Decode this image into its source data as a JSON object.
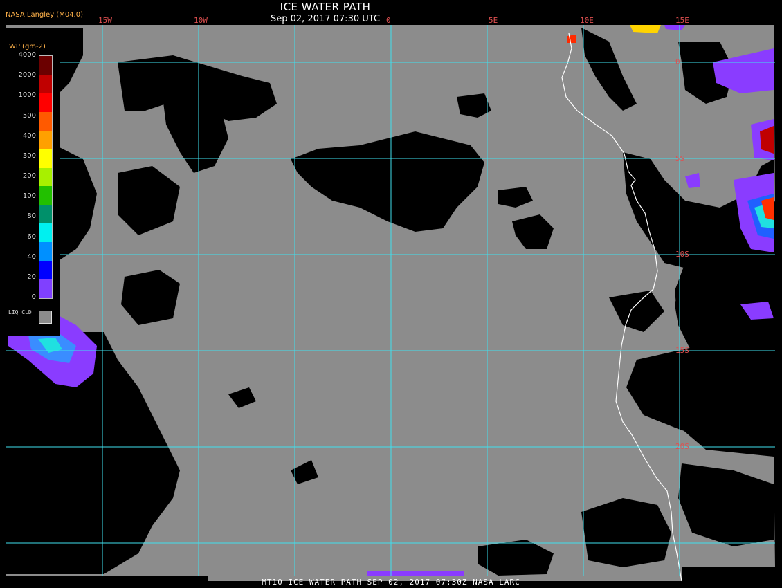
{
  "header": {
    "brand": "NASA Langley (M04.0)",
    "title": "ICE WATER PATH",
    "subtitle": "Sep 02, 2017 07:30 UTC"
  },
  "footer": {
    "text": "MT10  ICE WATER PATH   SEP 02, 2017 07:30Z   NASA LARC"
  },
  "grid": {
    "color": "#3fe0ee",
    "longitude_labels": [
      "15W",
      "10W",
      "0",
      "5E",
      "10E",
      "15E"
    ],
    "latitude_labels": [
      "0",
      "5S",
      "10S",
      "15S",
      "20S"
    ]
  },
  "legend": {
    "title": "IWP (gm-2)",
    "ticks": [
      "4000",
      "2000",
      "1000",
      "500",
      "400",
      "300",
      "200",
      "100",
      "80",
      "60",
      "40",
      "20",
      "0"
    ],
    "colors": [
      "#6b0000",
      "#c00000",
      "#ff0000",
      "#ff5a00",
      "#ffa000",
      "#ffff00",
      "#a8f000",
      "#22c000",
      "#00906a",
      "#00f0f0",
      "#0090ff",
      "#0000ff",
      "#8040ff"
    ],
    "liquid_label": "LIQ CLD",
    "liquid_color": "#8c8c8c"
  },
  "colors": {
    "clear": "#000000",
    "liquid_cloud": "#8c8c8c",
    "coast": "#ffffff"
  }
}
